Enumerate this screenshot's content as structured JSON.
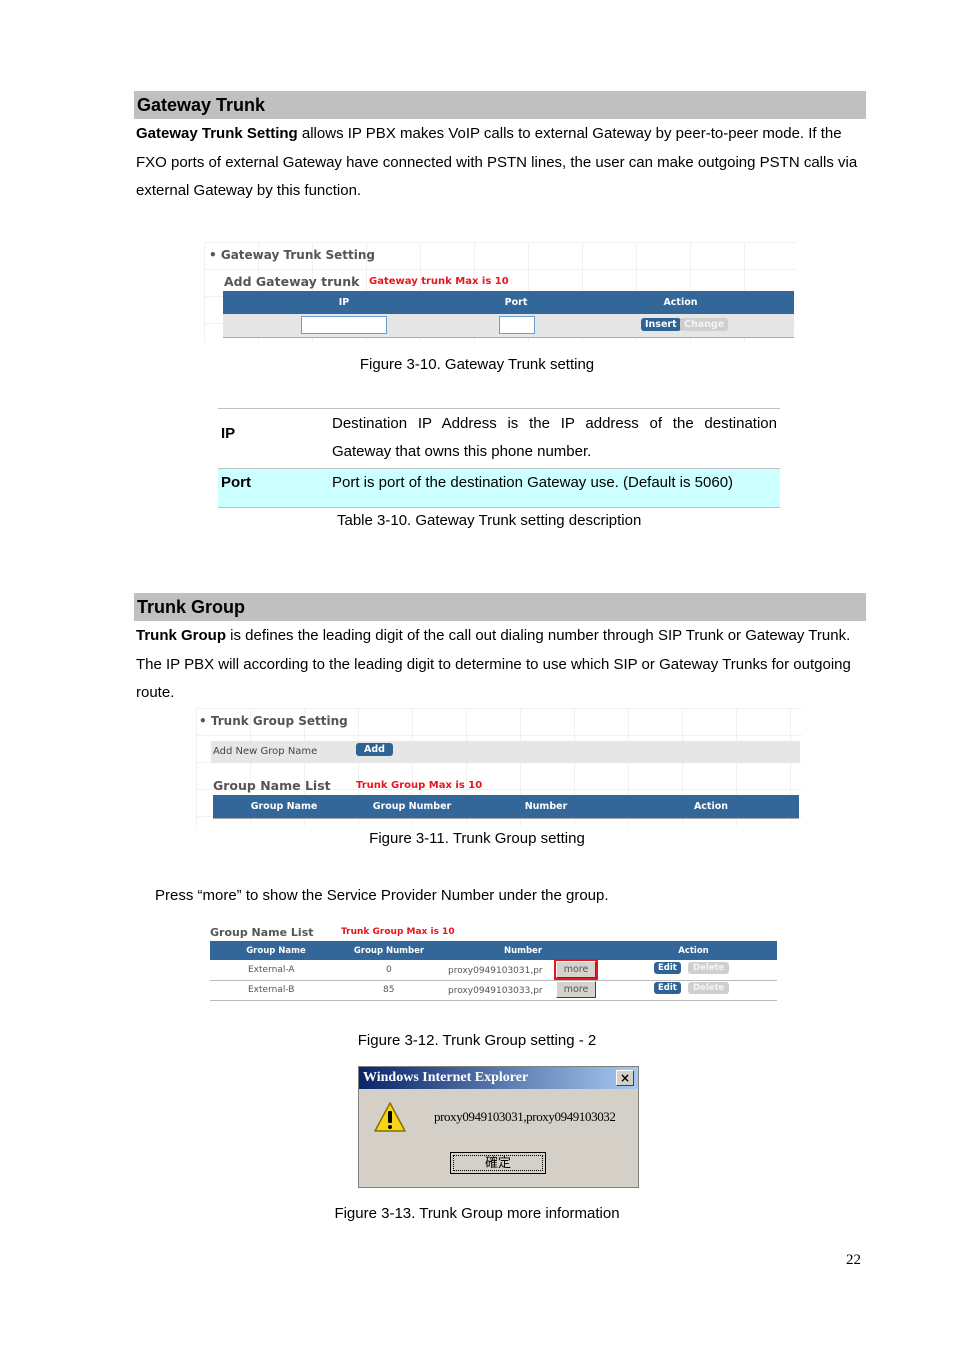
{
  "gateway_section": {
    "heading": "Gateway Trunk",
    "intro_bold": "Gateway Trunk Setting",
    "intro_rest": " allows IP PBX makes VoIP calls to external Gateway by peer-to-peer mode. If the FXO ports of external Gateway have connected with PSTN lines, the user can make outgoing PSTN calls via external Gateway by this function.",
    "figure": {
      "bullet_title": "Gateway Trunk Setting",
      "sub_title": "Add Gateway trunk",
      "max_note": "Gateway trunk Max is 10",
      "columns": [
        "IP",
        "Port",
        "Action"
      ],
      "ip_value": "",
      "port_value": "",
      "insert_label": "Insert",
      "change_label": "Change"
    },
    "figure_caption": "Figure 3-10. Gateway Trunk setting",
    "desc_table": {
      "rows": [
        {
          "key": "IP",
          "value": "Destination IP Address is the IP address of the destination Gateway that owns this phone number."
        },
        {
          "key": "Port",
          "value": "Port is port of the destination Gateway use. (Default is 5060)"
        }
      ],
      "highlight_color": "#ccffff",
      "caption": "Table 3-10. Gateway Trunk setting description"
    }
  },
  "trunk_section": {
    "heading": "Trunk Group",
    "intro_bold": "Trunk Group",
    "intro_rest": " is defines the leading digit of the call out dialing number through SIP Trunk or Gateway Trunk. The IP PBX will according to the leading digit to determine to use which SIP or Gateway Trunks for outgoing route.",
    "figure": {
      "bullet_title": "Trunk Group Setting",
      "add_label": "Add New Grop Name",
      "add_button": "Add",
      "list_title": "Group Name List",
      "max_note": "Trunk Group Max is 10",
      "columns": [
        "Group Name",
        "Group Number",
        "Number",
        "Action"
      ]
    },
    "figure_caption": "Figure 3-11. Trunk Group setting",
    "press_note": "Press “more” to show the Service Provider Number under the group.",
    "figure2": {
      "list_title": "Group Name List",
      "max_note": "Trunk Group Max is 10",
      "columns": [
        "Group Name",
        "Group Number",
        "Number",
        "Action"
      ],
      "rows": [
        {
          "name": "External-A",
          "group_number": "0",
          "number": "proxy0949103031,pr",
          "more": "more",
          "edit": "Edit",
          "delete": "Delete",
          "highlighted": true
        },
        {
          "name": "External-B",
          "group_number": "85",
          "number": "proxy0949103033,pr",
          "more": "more",
          "edit": "Edit",
          "delete": "Delete",
          "highlighted": false
        }
      ]
    },
    "figure2_caption": "Figure 3-12. Trunk Group setting - 2",
    "dialog": {
      "title": "Windows Internet Explorer",
      "close": "×",
      "message": "proxy0949103031,proxy0949103032",
      "ok_label": "確定",
      "icon": "warning-icon"
    },
    "dialog_caption": "Figure 3-13. Trunk Group more information"
  },
  "page_number": "22"
}
